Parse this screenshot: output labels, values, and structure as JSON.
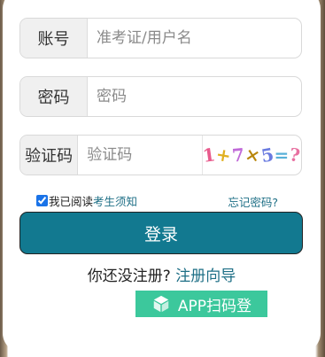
{
  "form": {
    "account": {
      "label": "账号",
      "placeholder": "准考证/用户名",
      "value": ""
    },
    "password": {
      "label": "密码",
      "placeholder": "密码",
      "value": ""
    },
    "captcha": {
      "label": "验证码",
      "placeholder": "验证码",
      "value": "",
      "image_chars": [
        "1",
        "+",
        "7",
        "×",
        "5",
        "=",
        "?"
      ]
    }
  },
  "agreement": {
    "checked": true,
    "prefix": "我已阅读",
    "link": "考生须知"
  },
  "forgot_password": "忘记密码?",
  "login_button": "登录",
  "register": {
    "prompt": "你还没注册?",
    "link": "注册向导"
  },
  "app_scan_button": "APP扫码登",
  "colors": {
    "primary": "#127990",
    "link": "#1e6f86",
    "app_button": "#3cc89c"
  },
  "icons": {
    "app_scan": "cube-icon"
  }
}
